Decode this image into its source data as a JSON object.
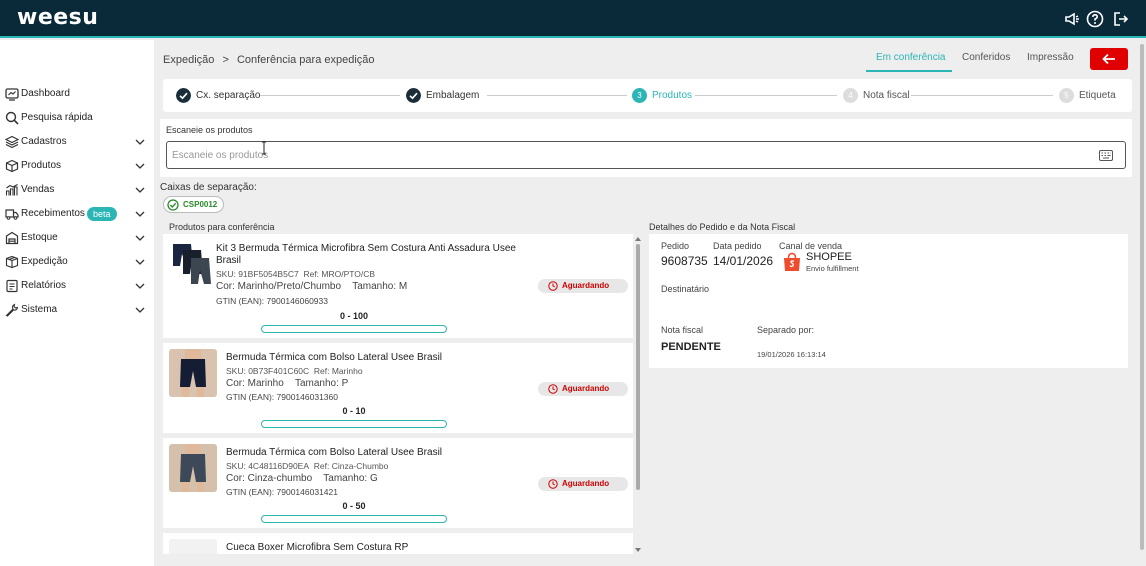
{
  "app": {
    "logo": "weesu"
  },
  "sidebar": {
    "items": [
      {
        "label": "Dashboard",
        "icon": "dashboard-icon",
        "expandable": false
      },
      {
        "label": "Pesquisa rápida",
        "icon": "search-icon",
        "expandable": false
      },
      {
        "label": "Cadastros",
        "icon": "layers-icon",
        "expandable": true
      },
      {
        "label": "Produtos",
        "icon": "box-icon",
        "expandable": true
      },
      {
        "label": "Vendas",
        "icon": "sales-chart-icon",
        "expandable": true
      },
      {
        "label": "Recebimentos",
        "icon": "truck-icon",
        "expandable": true,
        "badge": "beta"
      },
      {
        "label": "Estoque",
        "icon": "warehouse-icon",
        "expandable": true
      },
      {
        "label": "Expedição",
        "icon": "shipping-box-icon",
        "expandable": true
      },
      {
        "label": "Relatórios",
        "icon": "report-icon",
        "expandable": true
      },
      {
        "label": "Sistema",
        "icon": "wrench-icon",
        "expandable": true
      }
    ]
  },
  "breadcrumb": {
    "root": "Expedição",
    "separator": ">",
    "current": "Conferência para expedição"
  },
  "tabs": [
    {
      "label": "Em conferência",
      "active": true
    },
    {
      "label": "Conferidos",
      "active": false
    },
    {
      "label": "Impressão",
      "active": false
    }
  ],
  "stepper": {
    "steps": [
      {
        "label": "Cx. separação",
        "state": "done",
        "number": "1"
      },
      {
        "label": "Embalagem",
        "state": "done",
        "number": "2"
      },
      {
        "label": "Produtos",
        "state": "current",
        "number": "3"
      },
      {
        "label": "Nota fiscal",
        "state": "pending",
        "number": "4"
      },
      {
        "label": "Etiqueta",
        "state": "pending",
        "number": "5"
      }
    ]
  },
  "scan": {
    "title": "Escaneie os produtos",
    "placeholder": "Escaneie os produtos"
  },
  "boxes": {
    "title": "Caixas de separação:",
    "chips": [
      "CSP0012"
    ]
  },
  "products_section": {
    "title": "Produtos para conferência"
  },
  "products": [
    {
      "name": "Kit 3 Bermuda Térmica Microfibra Sem Costura Anti Assadura Usee Brasil",
      "sku": "SKU: 91BF5054B5C7",
      "ref": "Ref: MRO/PTO/CB",
      "cor": "Cor: Marinho/Preto/Chumbo",
      "tamanho": "Tamanho: M",
      "gtin": "GTIN (EAN): 7900146060933",
      "status": "Aguardando",
      "count": "0 - 100",
      "progress": 0
    },
    {
      "name": "Bermuda Térmica com Bolso Lateral Usee Brasil",
      "sku": "SKU: 0B73F401C60C",
      "ref": "Ref: Marinho",
      "cor": "Cor: Marinho",
      "tamanho": "Tamanho: P",
      "gtin": "GTIN (EAN): 7900146031360",
      "status": "Aguardando",
      "count": "0 - 10",
      "progress": 0
    },
    {
      "name": "Bermuda Térmica com Bolso Lateral Usee Brasil",
      "sku": "SKU: 4C48116D90EA",
      "ref": "Ref: Cinza-Chumbo",
      "cor": "Cor: Cinza-chumbo",
      "tamanho": "Tamanho: G",
      "gtin": "GTIN (EAN): 7900146031421",
      "status": "Aguardando",
      "count": "0 - 50",
      "progress": 0
    },
    {
      "name": "Cueca Boxer Microfibra Sem Costura RP"
    }
  ],
  "details": {
    "title": "Detalhes do Pedido e da Nota Fiscal",
    "pedido_label": "Pedido",
    "pedido_value": "9608735",
    "data_label": "Data pedido",
    "data_value": "14/01/2026",
    "canal_label": "Canal de venda",
    "canal_value": "SHOPEE",
    "canal_sub": "Envio fulfillment",
    "destinatario_label": "Destinatário",
    "nota_label": "Nota fiscal",
    "nota_value": "PENDENTE",
    "separado_label": "Separado por:",
    "separado_value": "19/01/2026 16:13:14"
  },
  "colors": {
    "topbar": "#0a2a3a",
    "accent": "#2bb5b5",
    "danger": "#e00000",
    "shopee": "#ee4d2d"
  }
}
